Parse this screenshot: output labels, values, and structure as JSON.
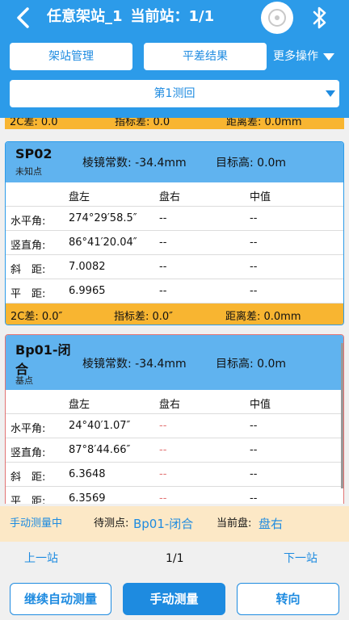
{
  "header": {
    "station_name": "任意架站_1",
    "current_station": "当前站：1/1",
    "icons": {
      "back": "chevron-left-icon",
      "device": "device-disc-icon",
      "bluetooth": "bluetooth-icon"
    },
    "station_manage_label": "架站管理",
    "adjust_result_label": "平差结果",
    "more_label": "更多操作",
    "round_select_value": "第1测回"
  },
  "cut_row": {
    "c2": "2C差: 0.0",
    "index": "指标差: 0.0",
    "dist": "距离差: 0.0mm"
  },
  "cards": [
    {
      "name": "SP02",
      "type": "未知点",
      "prism": "棱镜常数: -34.4mm",
      "target_height": "目标高:  0.0m",
      "header": {
        "left": "盘左",
        "right": "盘右",
        "mid": "中值"
      },
      "rows": [
        {
          "label": "水平角:",
          "left": "274°29′58.5″",
          "right": "--",
          "mid": "--"
        },
        {
          "label": "竖直角:",
          "left": "86°41′20.04″",
          "right": "--",
          "mid": "--"
        },
        {
          "label": "斜　距:",
          "left": "7.0082",
          "right": "--",
          "mid": "--"
        },
        {
          "label": "平　距:",
          "left": "6.9965",
          "right": "--",
          "mid": "--"
        }
      ],
      "footer": {
        "c2": "2C差: 0.0″",
        "index": "指标差: 0.0″",
        "dist": "距离差: 0.0mm"
      }
    },
    {
      "name_line1": "Bp01-闭",
      "name_line2": "合",
      "type": "基点",
      "prism": "棱镜常数: -34.4mm",
      "target_height": "目标高:  0.0m",
      "header": {
        "left": "盘左",
        "right": "盘右",
        "mid": "中值"
      },
      "rows": [
        {
          "label": "水平角:",
          "left": "24°40′1.07″",
          "right": "--",
          "mid": "--"
        },
        {
          "label": "竖直角:",
          "left": "87°8′44.66″",
          "right": "--",
          "mid": "--"
        },
        {
          "label": "斜　距:",
          "left": "6.3648",
          "right": "--",
          "mid": "--"
        },
        {
          "label": "平　距:",
          "left": "6.3569",
          "right": "--",
          "mid": "--"
        }
      ]
    }
  ],
  "status": {
    "mode": "手动测量中",
    "pending_label": "待测点:",
    "pending_value": "Bp01-闭合",
    "face_label": "当前盘:",
    "face_value": "盘右"
  },
  "pager": {
    "prev": "上一站",
    "page": "1/1",
    "next": "下一站"
  },
  "buttons": {
    "continue_auto": "继续自动测量",
    "manual": "手动测量",
    "turn": "转向"
  },
  "colors": {
    "primary": "#2c9be9",
    "accent_text": "#1e8be0",
    "warning": "#f8b531",
    "status_bg": "#fce8c6"
  }
}
